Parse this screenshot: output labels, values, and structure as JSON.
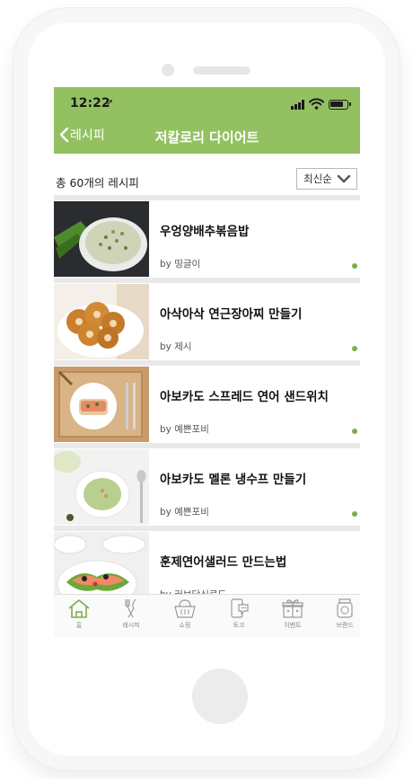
{
  "status_bar": {
    "time": "12:22",
    "location_glyph": "➚",
    "battery_level": 0.85
  },
  "header": {
    "back_label": "레시피",
    "title": "저칼로리 다이어트"
  },
  "toolbar": {
    "count_text": "총 60개의 레시피",
    "sort_selected": "최신순"
  },
  "recipes": [
    {
      "title": "우엉양배추볶음밥",
      "author": "by 띵글이",
      "thumb": "rice-bowl"
    },
    {
      "title": "아삭아삭 연근장아찌 만들기",
      "author": "by 제시",
      "thumb": "lotus-root"
    },
    {
      "title": "아보카도 스프레드 연어 샌드위치",
      "author": "by 예쁜포비",
      "thumb": "salmon-sandwich"
    },
    {
      "title": "아보카도 멜론 냉수프 만들기",
      "author": "by 예쁜포비",
      "thumb": "green-soup"
    },
    {
      "title": "훈제연어샐러드 만드는법",
      "author": "by 러브당신로드",
      "thumb": "salmon-salad"
    }
  ],
  "tabs": [
    {
      "label": "홈",
      "icon": "house-icon",
      "active": true
    },
    {
      "label": "레시피",
      "icon": "fork-knife-icon",
      "active": false
    },
    {
      "label": "쇼핑",
      "icon": "basket-icon",
      "active": false
    },
    {
      "label": "토크",
      "icon": "phone-chat-icon",
      "active": false
    },
    {
      "label": "이벤트",
      "icon": "gift-box-icon",
      "active": false
    },
    {
      "label": "브랜드",
      "icon": "jar-icon",
      "active": false
    }
  ],
  "colors": {
    "brand_green": "#93c161",
    "active_green": "#7ab04a"
  }
}
